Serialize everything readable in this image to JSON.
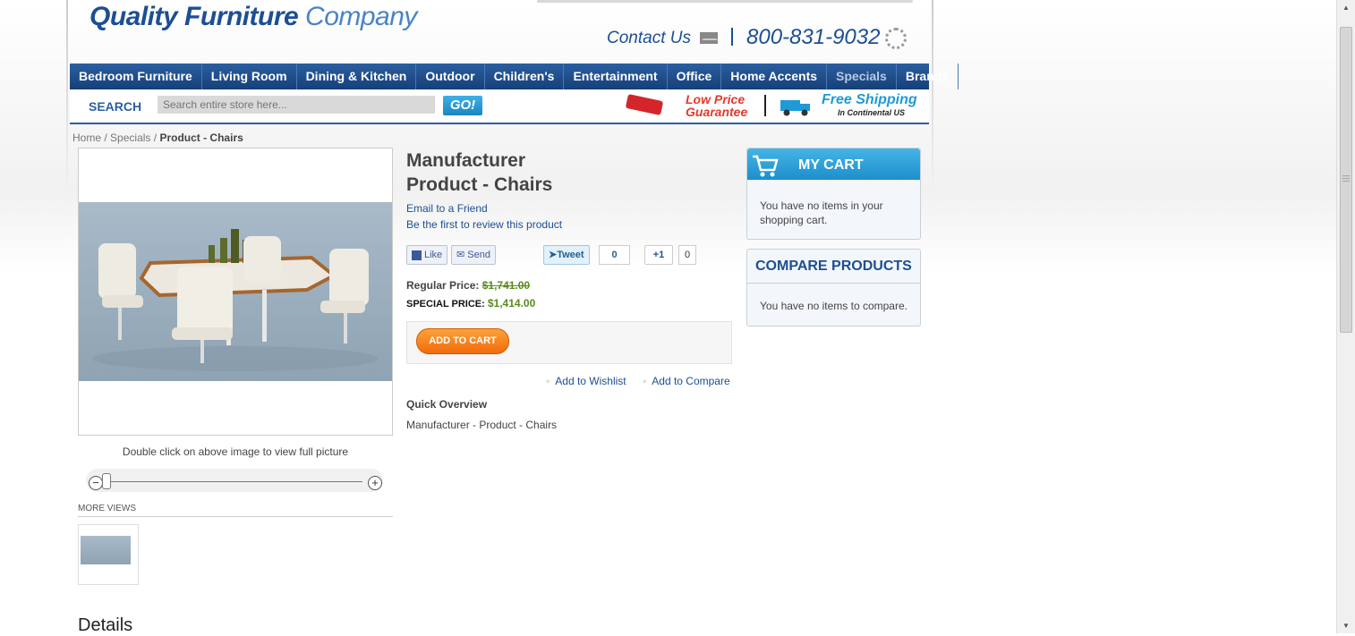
{
  "header": {
    "logo_main": "Quality Furniture",
    "logo_sub": "Company",
    "contact_label": "Contact Us",
    "phone": "800-831-9032"
  },
  "nav": {
    "items": [
      "Bedroom Furniture",
      "Living Room",
      "Dining & Kitchen",
      "Outdoor",
      "Children's",
      "Entertainment",
      "Office",
      "Home Accents",
      "Specials",
      "Brands"
    ],
    "active": "Specials"
  },
  "search": {
    "label": "SEARCH",
    "placeholder": "Search entire store here...",
    "go_label": "GO!"
  },
  "promos": {
    "low_price_line1": "Low Price",
    "low_price_line2": "Guarantee",
    "free_shipping": "Free Shipping",
    "continental": "In Continental US"
  },
  "breadcrumb": {
    "home": "Home",
    "specials": "Specials",
    "current": "Product - Chairs",
    "separator": "/"
  },
  "product": {
    "title_line1": "Manufacturer",
    "title_line2": "Product - Chairs",
    "email_friend": "Email to a Friend",
    "review": "Be the first to review this product",
    "social": {
      "like": "Like",
      "send": "Send",
      "tweet": "Tweet",
      "tweet_count": "0",
      "plusone": "+1",
      "plusone_count": "0"
    },
    "regular_price_label": "Regular Price:",
    "regular_price": "$1,741.00",
    "special_price_label": "SPECIAL PRICE:",
    "special_price": "$1,414.00",
    "add_to_cart": "ADD TO CART",
    "add_to_wishlist": "Add to Wishlist",
    "add_to_compare": "Add to Compare",
    "quick_overview_title": "Quick Overview",
    "quick_overview_text": "Manufacturer - Product - Chairs",
    "image_hint": "Double click on above image to view full picture",
    "more_views": "MORE VIEWS",
    "details_heading": "Details"
  },
  "sidebar": {
    "cart_title": "MY CART",
    "cart_text": "You have no items in your shopping cart.",
    "compare_title": "COMPARE PRODUCTS",
    "compare_text": "You have no items to compare."
  },
  "colors": {
    "brand_blue": "#1c4f93",
    "nav_blue": "#2b5fa0",
    "price_green": "#5a8a1f",
    "cart_orange": "#f26b0b",
    "cart_header": "#1d8ecb"
  }
}
